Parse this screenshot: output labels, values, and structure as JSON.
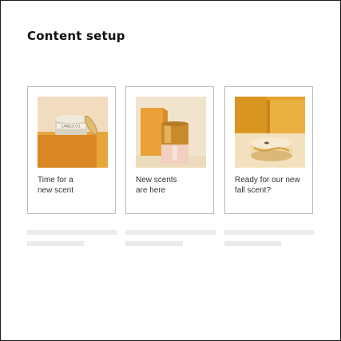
{
  "page": {
    "title": "Content setup"
  },
  "cards": [
    {
      "caption": "Time for a\nnew scent",
      "image_icon": "candle-tin-image"
    },
    {
      "caption": "New scents\nare here",
      "image_icon": "pillar-candle-image"
    },
    {
      "caption": "Ready for our new\nfall scent?",
      "image_icon": "glass-candle-image"
    }
  ],
  "colors": {
    "placeholder_bar": "#ebebeb",
    "card_border": "#bdbdbd",
    "mustard": "#e2a32a",
    "orange": "#d9801e",
    "cream": "#f3e3c4"
  }
}
